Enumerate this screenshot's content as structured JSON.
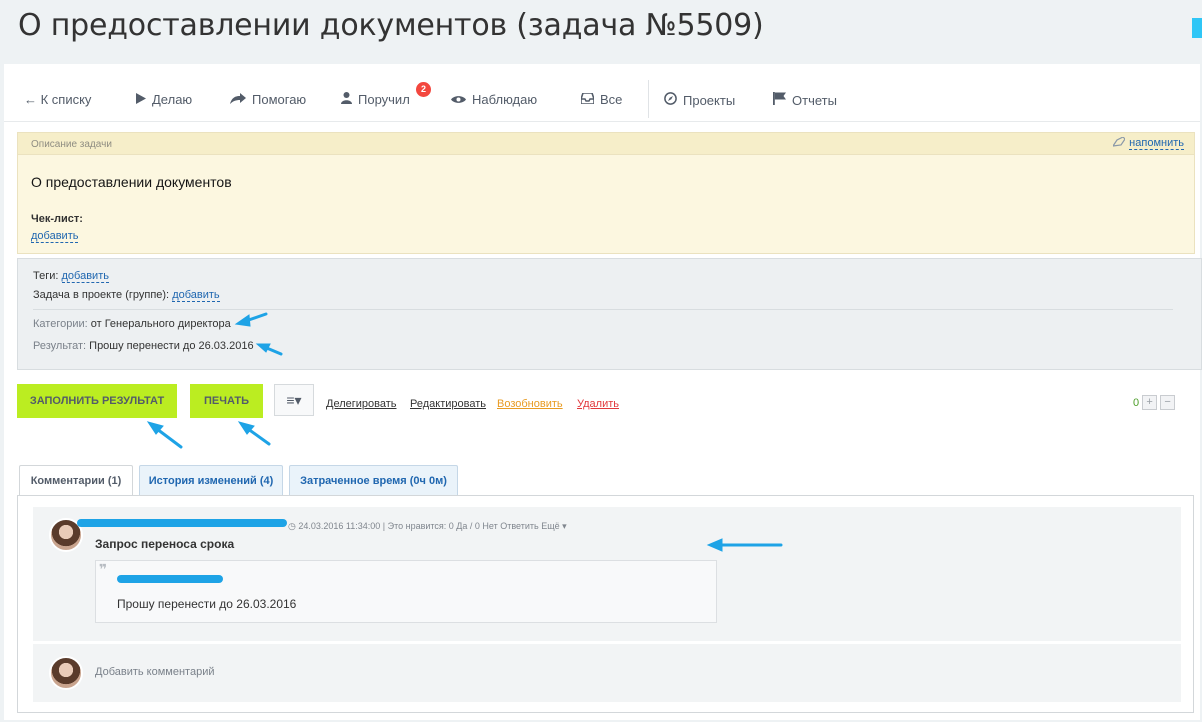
{
  "title": "О предоставлении документов (задача №5509)",
  "nav": {
    "back": "← К списку",
    "doing": "Делаю",
    "helping": "Помогаю",
    "assigned": "Поручил",
    "assigned_badge": "2",
    "watching": "Наблюдаю",
    "all": "Все",
    "projects": "Проекты",
    "reports": "Отчеты"
  },
  "description": {
    "header": "Описание задачи",
    "remind": "напомнить",
    "text": "О предоставлении документов",
    "checklist_label": "Чек-лист:",
    "checklist_add": "добавить"
  },
  "meta": {
    "tags_label": "Теги:",
    "tags_add": "добавить",
    "project_label": "Задача в проекте (группе):",
    "project_add": "добавить",
    "category_label": "Категории:",
    "category_value": "от Генерального директора",
    "result_label": "Результат:",
    "result_value": "Прошу перенести до 26.03.2016"
  },
  "actions": {
    "fill_result": "ЗАПОЛНИТЬ РЕЗУЛЬТАТ",
    "print": "ПЕЧАТЬ",
    "menu": "≡▾",
    "delegate": "Делегировать",
    "edit": "Редактировать",
    "renew": "Возобновить",
    "delete": "Удалить",
    "counter": "0"
  },
  "tabs": {
    "comments": "Комментарии (1)",
    "history": "История изменений (4)",
    "time": "Затраченное время (0ч 0м)"
  },
  "comment": {
    "meta": "◷ 24.03.2016 11:34:00    |  Это нравится: 0 Да / 0 Нет    Ответить    Ещё ▾",
    "title": "Запрос переноса срока",
    "quote_text": "Прошу перенести до 26.03.2016"
  },
  "add_comment": "Добавить комментарий",
  "colors": {
    "accent_green": "#bbed21",
    "link_blue": "#2067b0",
    "annotation_blue": "#1ea3e6",
    "badge_red": "#f3473e"
  }
}
